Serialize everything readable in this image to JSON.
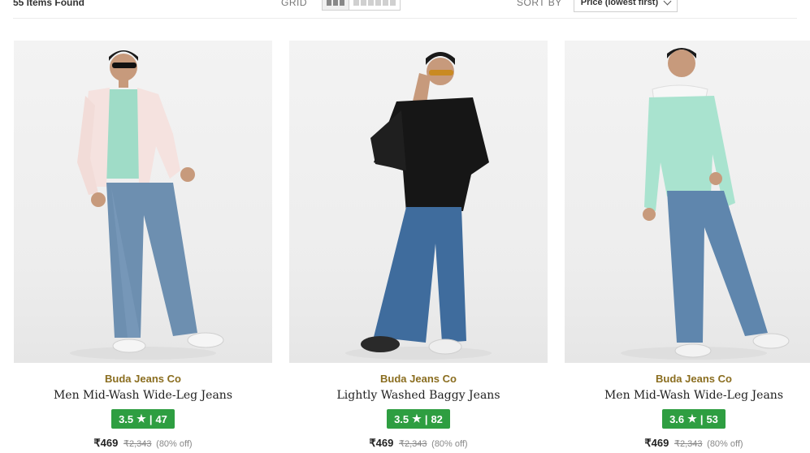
{
  "toolbar": {
    "items_found": "55 Items Found",
    "grid_label": "GRID",
    "sort_label": "SORT BY",
    "sort_value": "Price (lowest first)"
  },
  "products": [
    {
      "brand": "Buda Jeans Co",
      "title": "Men Mid-Wash Wide-Leg Jeans",
      "rating": "3.5",
      "reviews": "47",
      "price": "₹469",
      "mrp": "₹2,343",
      "discount": "(80% off)",
      "image": {
        "top": "#f6dede",
        "top_style": "open overshirt over mint tee",
        "jeans": "#6d8fb0"
      }
    },
    {
      "brand": "Buda Jeans Co",
      "title": "Lightly Washed Baggy Jeans",
      "rating": "3.5",
      "reviews": "82",
      "price": "₹469",
      "mrp": "₹2,343",
      "discount": "(80% off)",
      "image": {
        "top": "#151515",
        "top_style": "black shirt",
        "jeans": "#3f6c9d"
      }
    },
    {
      "brand": "Buda Jeans Co",
      "title": "Men Mid-Wash Wide-Leg Jeans",
      "rating": "3.6",
      "reviews": "53",
      "price": "₹469",
      "mrp": "₹2,343",
      "discount": "(80% off)",
      "image": {
        "top": "#a9e3cf",
        "top_style": "mint sweatshirt",
        "jeans": "#5f86ad"
      }
    }
  ],
  "rating_icon": "star-icon",
  "colors": {
    "rating_bg": "#2e9e41",
    "brand": "#8a6d1f"
  }
}
